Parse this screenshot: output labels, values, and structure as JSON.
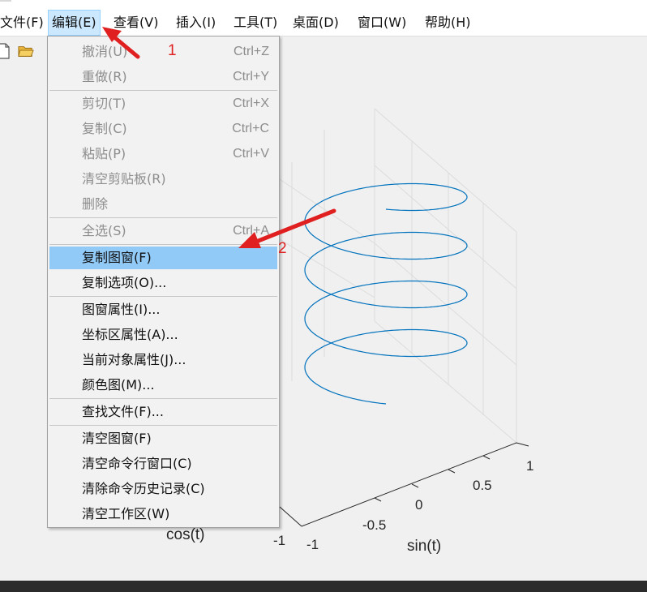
{
  "menubar": {
    "items": [
      {
        "label": "文件(F)"
      },
      {
        "label": "编辑(E)"
      },
      {
        "label": "查看(V)"
      },
      {
        "label": "插入(I)"
      },
      {
        "label": "工具(T)"
      },
      {
        "label": "桌面(D)"
      },
      {
        "label": "窗口(W)"
      },
      {
        "label": "帮助(H)"
      }
    ]
  },
  "edit_menu": {
    "items": [
      {
        "label": "撤消(U)",
        "shortcut": "Ctrl+Z",
        "enabled": false
      },
      {
        "label": "重做(R)",
        "shortcut": "Ctrl+Y",
        "enabled": false
      },
      {
        "label": "剪切(T)",
        "shortcut": "Ctrl+X",
        "enabled": false
      },
      {
        "label": "复制(C)",
        "shortcut": "Ctrl+C",
        "enabled": false
      },
      {
        "label": "粘贴(P)",
        "shortcut": "Ctrl+V",
        "enabled": false
      },
      {
        "label": "清空剪贴板(R)",
        "shortcut": "",
        "enabled": false
      },
      {
        "label": "删除",
        "shortcut": "",
        "enabled": false
      },
      {
        "label": "全选(S)",
        "shortcut": "Ctrl+A",
        "enabled": false
      },
      {
        "label": "复制图窗(F)",
        "shortcut": "",
        "enabled": true,
        "highlighted": true
      },
      {
        "label": "复制选项(O)...",
        "shortcut": "",
        "enabled": true
      },
      {
        "label": "图窗属性(I)...",
        "shortcut": "",
        "enabled": true
      },
      {
        "label": "坐标区属性(A)...",
        "shortcut": "",
        "enabled": true
      },
      {
        "label": "当前对象属性(J)...",
        "shortcut": "",
        "enabled": true
      },
      {
        "label": "颜色图(M)...",
        "shortcut": "",
        "enabled": true
      },
      {
        "label": "查找文件(F)...",
        "shortcut": "",
        "enabled": true
      },
      {
        "label": "清空图窗(F)",
        "shortcut": "",
        "enabled": true
      },
      {
        "label": "清空命令行窗口(C)",
        "shortcut": "",
        "enabled": true
      },
      {
        "label": "清除命令历史记录(C)",
        "shortcut": "",
        "enabled": true
      },
      {
        "label": "清空工作区(W)",
        "shortcut": "",
        "enabled": true
      }
    ]
  },
  "plot": {
    "x_ticks": [
      "1",
      "0.5",
      "0",
      "-0.5",
      "-1"
    ],
    "y_tick_visible": "-1",
    "xlabel": "sin(t)",
    "ylabel": "cos(t)",
    "line_color": "#0072bd"
  },
  "annotations": {
    "step1": "1",
    "step2": "2",
    "arrow_color": "#e02020"
  },
  "colors": {
    "highlight": "#91c9f7",
    "menu_active": "#cce8ff"
  }
}
